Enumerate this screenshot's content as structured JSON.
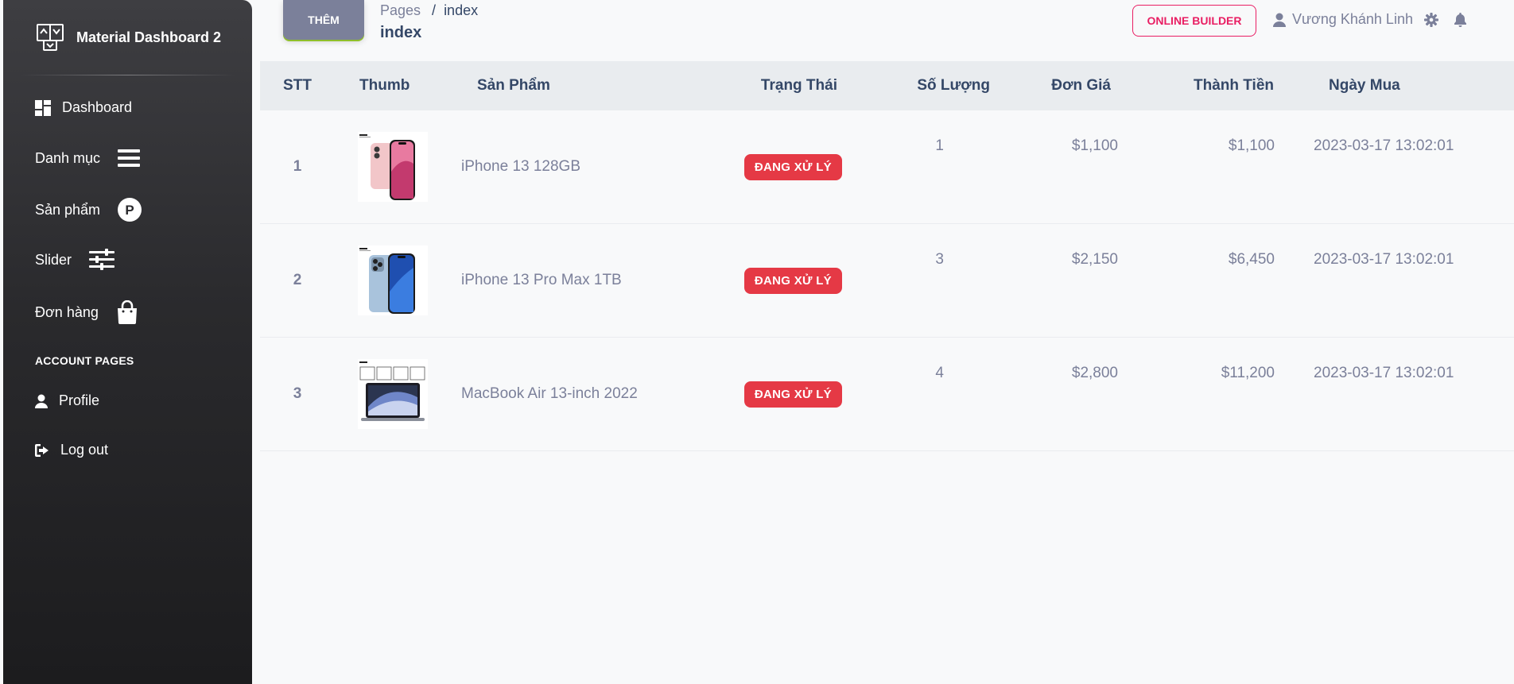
{
  "sidebar": {
    "brand": "Material Dashboard 2",
    "items": [
      {
        "label": "Dashboard",
        "icon": "dashboard-icon"
      },
      {
        "label": "Danh mục",
        "icon": "menu-icon"
      },
      {
        "label": "Sản phẩm",
        "icon": "product-p-icon"
      },
      {
        "label": "Slider",
        "icon": "sliders-icon"
      },
      {
        "label": "Đơn hàng",
        "icon": "shopping-bag-icon"
      }
    ],
    "section_title": "ACCOUNT PAGES",
    "account_items": [
      {
        "label": "Profile",
        "icon": "user-icon"
      },
      {
        "label": "Log out",
        "icon": "logout-icon"
      }
    ]
  },
  "header": {
    "add_button": "THÊM",
    "breadcrumb_root": "Pages",
    "breadcrumb_sep": "/",
    "breadcrumb_current": "index",
    "title": "index",
    "online_builder": "ONLINE BUILDER",
    "user_name": "Vương Khánh Linh"
  },
  "table": {
    "columns": [
      "STT",
      "Thumb",
      "Sản Phẩm",
      "Trạng Thái",
      "Số Lượng",
      "Đơn Giá",
      "Thành Tiền",
      "Ngày Mua"
    ],
    "rows": [
      {
        "stt": "1",
        "product": "iPhone 13 128GB",
        "status": "ĐANG XỬ LÝ",
        "qty": "1",
        "price": "$1,100",
        "total": "$1,100",
        "date": "2023-03-17 13:02:01"
      },
      {
        "stt": "2",
        "product": "iPhone 13 Pro Max 1TB",
        "status": "ĐANG XỬ LÝ",
        "qty": "3",
        "price": "$2,150",
        "total": "$6,450",
        "date": "2023-03-17 13:02:01"
      },
      {
        "stt": "3",
        "product": "MacBook Air 13-inch 2022",
        "status": "ĐANG XỬ LÝ",
        "qty": "4",
        "price": "$2,800",
        "total": "$11,200",
        "date": "2023-03-17 13:02:01"
      }
    ]
  },
  "colors": {
    "sidebar_bg": "#2a2a2d",
    "badge": "#e53945",
    "accent_pink": "#e91e63",
    "text_muted": "#7b809a",
    "text_dark": "#344767"
  }
}
